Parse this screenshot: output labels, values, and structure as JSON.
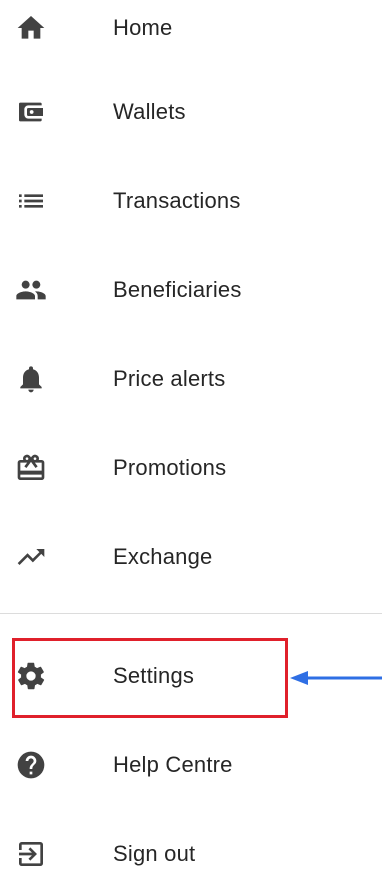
{
  "menu": {
    "items": [
      {
        "label": "Home",
        "icon": "home-icon"
      },
      {
        "label": "Wallets",
        "icon": "wallet-icon"
      },
      {
        "label": "Transactions",
        "icon": "list-icon"
      },
      {
        "label": "Beneficiaries",
        "icon": "people-icon"
      },
      {
        "label": "Price alerts",
        "icon": "bell-icon"
      },
      {
        "label": "Promotions",
        "icon": "gift-card-icon"
      },
      {
        "label": "Exchange",
        "icon": "trending-up-icon"
      },
      {
        "label": "Settings",
        "icon": "gear-icon"
      },
      {
        "label": "Help Centre",
        "icon": "help-circle-icon"
      },
      {
        "label": "Sign out",
        "icon": "sign-out-icon"
      }
    ]
  },
  "annotation": {
    "highlight_color": "#e0202b",
    "arrow_color": "#2f6fe4",
    "target": "Settings"
  }
}
